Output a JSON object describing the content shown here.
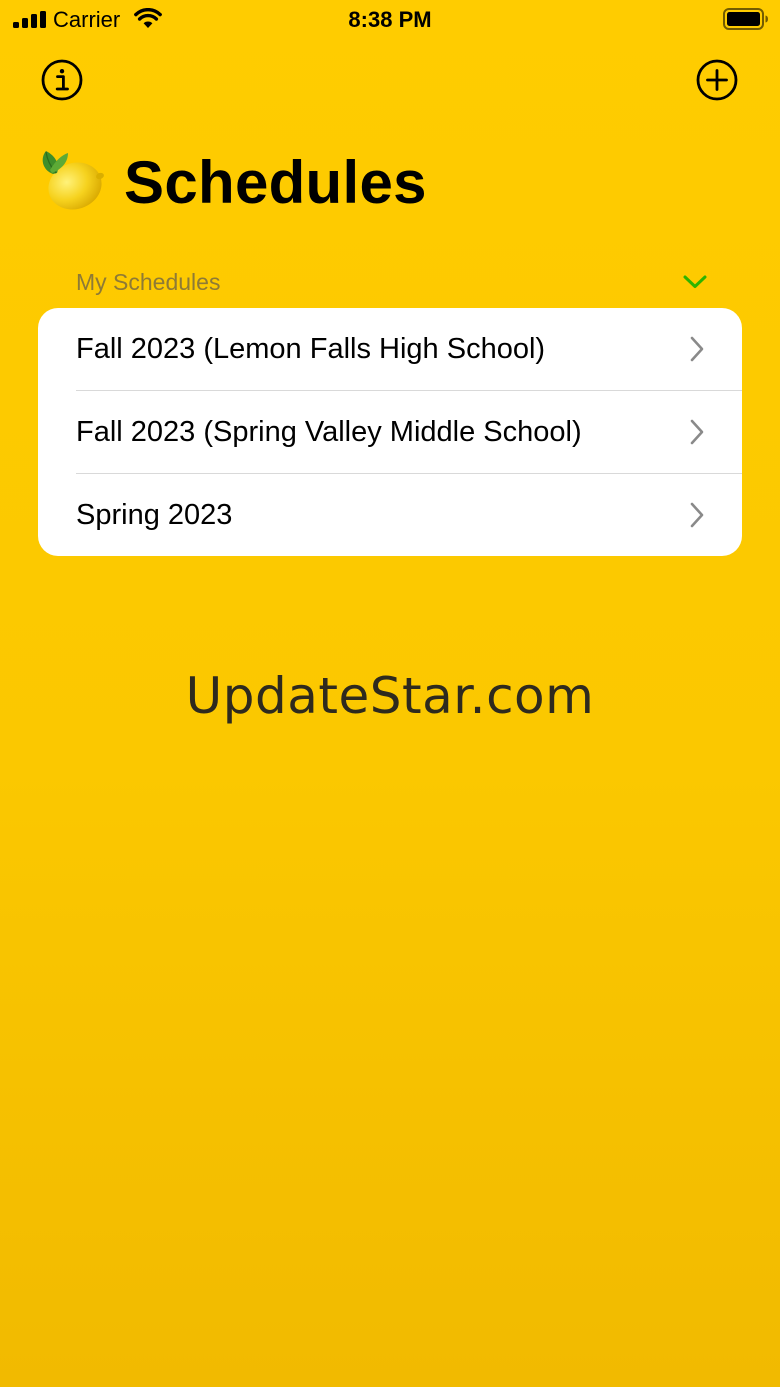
{
  "status_bar": {
    "carrier": "Carrier",
    "time": "8:38 PM",
    "icons": [
      "signal-icon",
      "wifi-icon",
      "battery-icon"
    ]
  },
  "toolbar": {
    "left_icon": "info-icon",
    "right_icon": "plus-circle-icon"
  },
  "header": {
    "emoji_icon": "lemon-icon",
    "title": "Schedules"
  },
  "section": {
    "label": "My Schedules",
    "toggle_icon": "chevron-down-icon"
  },
  "schedules": [
    {
      "label": "Fall 2023 (Lemon Falls High School)"
    },
    {
      "label": "Fall 2023 (Spring Valley Middle School)"
    },
    {
      "label": "Spring 2023"
    }
  ],
  "watermark": "UpdateStar.com",
  "colors": {
    "background": "#FFCC00",
    "card": "#FFFFFF",
    "section_label": "#8E7A36",
    "accent_chevron": "#2DB400",
    "row_chevron": "#8A8A8A"
  }
}
